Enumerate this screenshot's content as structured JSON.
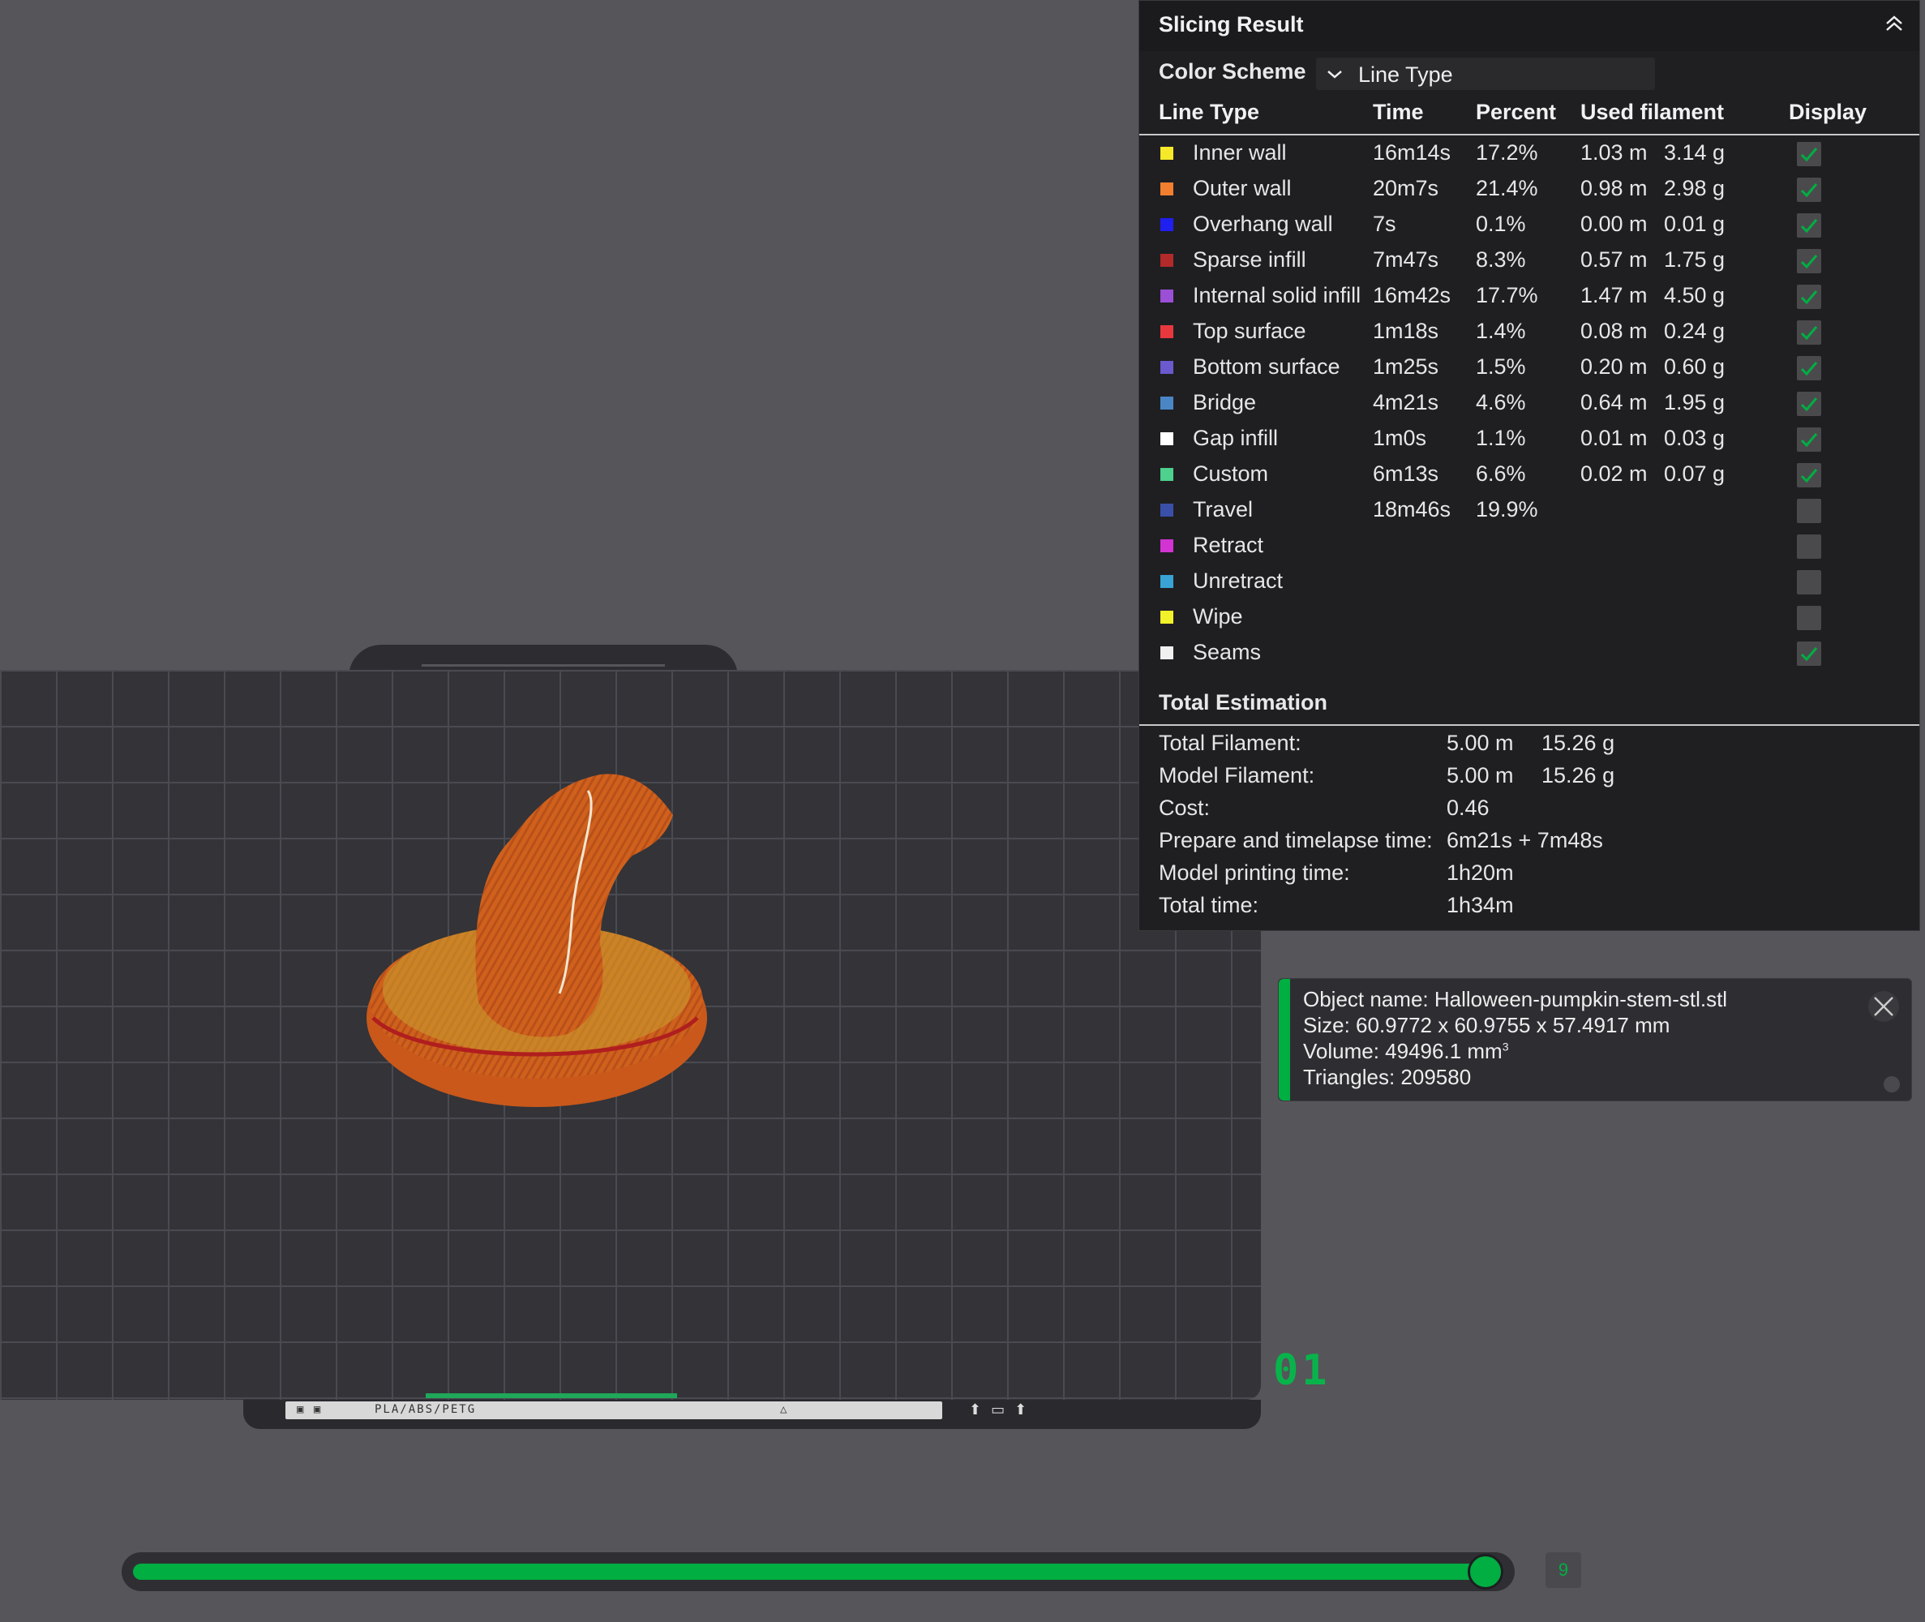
{
  "panel": {
    "title": "Slicing Result",
    "color_scheme_label": "Color Scheme",
    "color_scheme_value": "Line Type",
    "columns": [
      "Line Type",
      "Time",
      "Percent",
      "Used filament",
      "Display"
    ],
    "rows": [
      {
        "name": "Inner wall",
        "color": "#f6e92a",
        "time": "16m14s",
        "percent": "17.2%",
        "length": "1.03 m",
        "weight": "3.14 g",
        "display": true
      },
      {
        "name": "Outer wall",
        "color": "#f27f2f",
        "time": "20m7s",
        "percent": "21.4%",
        "length": "0.98 m",
        "weight": "2.98 g",
        "display": true
      },
      {
        "name": "Overhang wall",
        "color": "#1f1ff0",
        "time": "7s",
        "percent": "0.1%",
        "length": "0.00 m",
        "weight": "0.01 g",
        "display": true
      },
      {
        "name": "Sparse infill",
        "color": "#b22a2a",
        "time": "7m47s",
        "percent": "8.3%",
        "length": "0.57 m",
        "weight": "1.75 g",
        "display": true
      },
      {
        "name": "Internal solid infill",
        "color": "#9a4fd6",
        "time": "16m42s",
        "percent": "17.7%",
        "length": "1.47 m",
        "weight": "4.50 g",
        "display": true
      },
      {
        "name": "Top surface",
        "color": "#e8383e",
        "time": "1m18s",
        "percent": "1.4%",
        "length": "0.08 m",
        "weight": "0.24 g",
        "display": true
      },
      {
        "name": "Bottom surface",
        "color": "#6a5acd",
        "time": "1m25s",
        "percent": "1.5%",
        "length": "0.20 m",
        "weight": "0.60 g",
        "display": true
      },
      {
        "name": "Bridge",
        "color": "#4a86c6",
        "time": "4m21s",
        "percent": "4.6%",
        "length": "0.64 m",
        "weight": "1.95 g",
        "display": true
      },
      {
        "name": "Gap infill",
        "color": "#ffffff",
        "time": "1m0s",
        "percent": "1.1%",
        "length": "0.01 m",
        "weight": "0.03 g",
        "display": true
      },
      {
        "name": "Custom",
        "color": "#4ed18c",
        "time": "6m13s",
        "percent": "6.6%",
        "length": "0.02 m",
        "weight": "0.07 g",
        "display": true
      },
      {
        "name": "Travel",
        "color": "#3a4fa8",
        "time": "18m46s",
        "percent": "19.9%",
        "length": "",
        "weight": "",
        "display": false
      },
      {
        "name": "Retract",
        "color": "#d233d2",
        "time": "",
        "percent": "",
        "length": "",
        "weight": "",
        "display": false
      },
      {
        "name": "Unretract",
        "color": "#3aa3d6",
        "time": "",
        "percent": "",
        "length": "",
        "weight": "",
        "display": false
      },
      {
        "name": "Wipe",
        "color": "#f2f22a",
        "time": "",
        "percent": "",
        "length": "",
        "weight": "",
        "display": false
      },
      {
        "name": "Seams",
        "color": "#f0f0f0",
        "time": "",
        "percent": "",
        "length": "",
        "weight": "",
        "display": true
      }
    ],
    "total_estimation_title": "Total Estimation",
    "estimation": [
      {
        "label": "Total Filament:",
        "v1": "5.00 m",
        "v2": "15.26 g"
      },
      {
        "label": "Model Filament:",
        "v1": "5.00 m",
        "v2": "15.26 g"
      },
      {
        "label": "Cost:",
        "v1": "0.46",
        "v2": ""
      },
      {
        "label": "Prepare and timelapse time:",
        "v1": "6m21s + 7m48s",
        "v2": ""
      },
      {
        "label": "Model printing time:",
        "v1": "1h20m",
        "v2": ""
      },
      {
        "label": "Total time:",
        "v1": "1h34m",
        "v2": ""
      }
    ]
  },
  "object_info": {
    "name_line": "Object name: Halloween-pumpkin-stem-stl.stl",
    "size_line": "Size: 60.9772 x 60.9755 x 57.4917 mm",
    "volume_line": "Volume: 49496.1 mm",
    "volume_unit_sup": "3",
    "triangles_line": "Triangles: 209580",
    "accent_color": "#00ae42"
  },
  "plate": {
    "label_text": "PLA/ABS/PETG",
    "plate_number": "01"
  },
  "layer_slider": {
    "value": "9",
    "fraction": 1.0,
    "accent_color": "#00ae42"
  }
}
